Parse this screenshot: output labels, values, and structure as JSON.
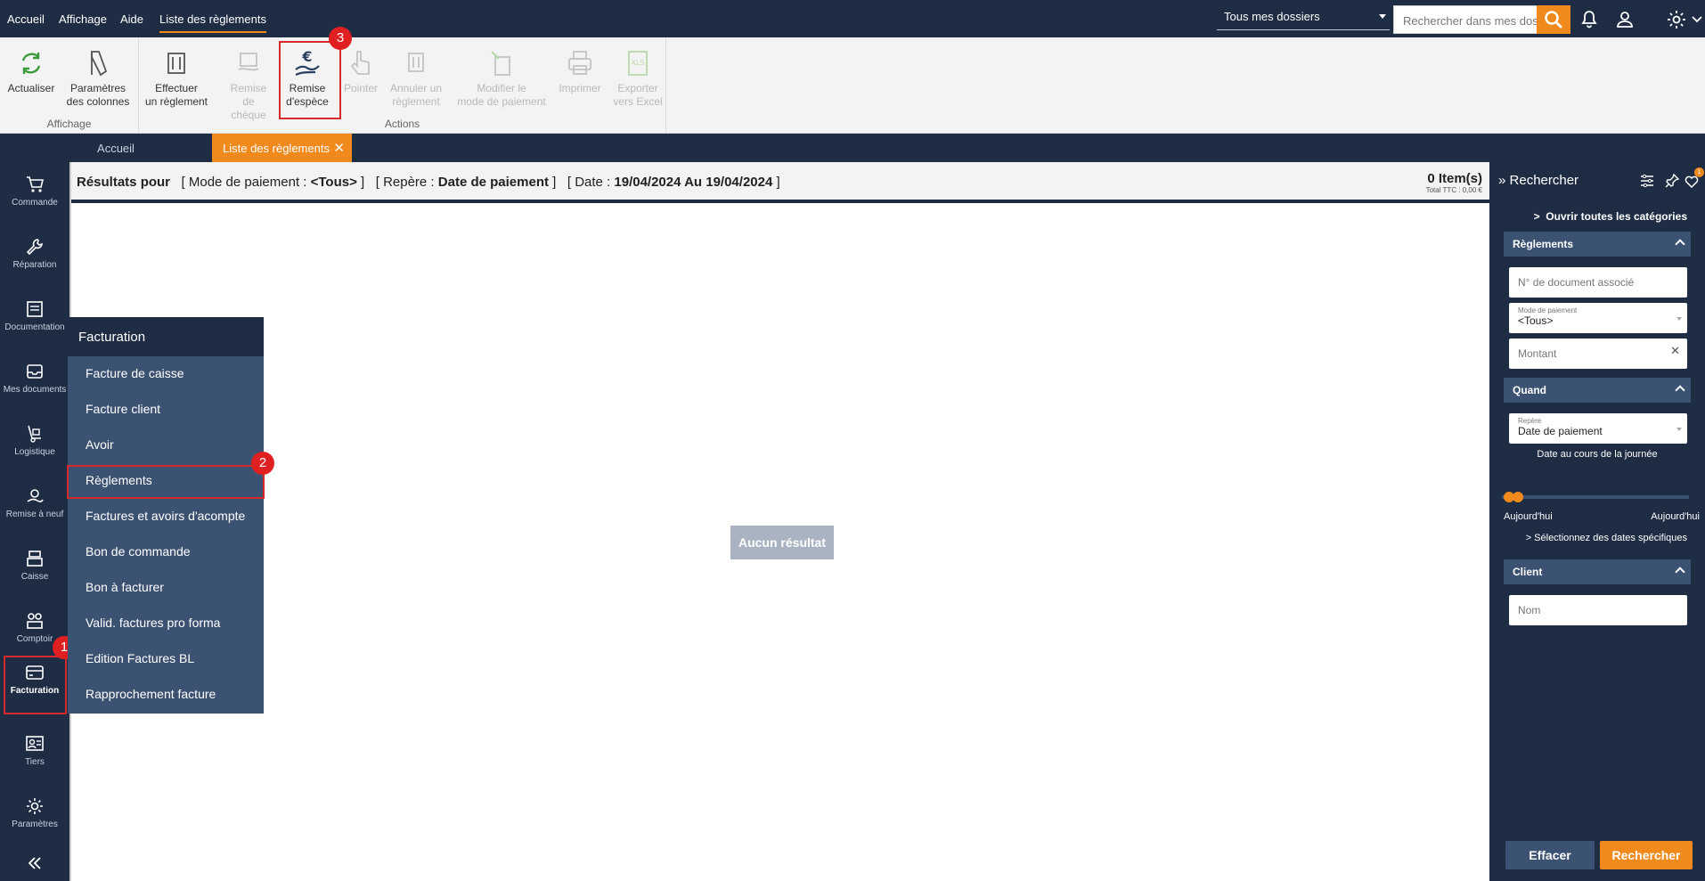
{
  "menubar": {
    "items": [
      "Accueil",
      "Affichage",
      "Aide",
      "Liste des règlements"
    ],
    "folder_select": "Tous mes dossiers",
    "search_placeholder": "Rechercher dans mes dossiers"
  },
  "ribbon": {
    "affichage": {
      "label": "Affichage",
      "buttons": [
        {
          "line1": "Actualiser",
          "line2": ""
        },
        {
          "line1": "Paramètres",
          "line2": "des colonnes"
        }
      ]
    },
    "actions": {
      "label": "Actions",
      "buttons": [
        {
          "line1": "Effectuer",
          "line2": "un règlement"
        },
        {
          "line1": "Remise",
          "line2": "de chèque"
        },
        {
          "line1": "Remise",
          "line2": "d'espèce"
        },
        {
          "line1": "Pointer",
          "line2": ""
        },
        {
          "line1": "Annuler un",
          "line2": "règlement"
        },
        {
          "line1": "Modifier le",
          "line2": "mode de paiement"
        },
        {
          "line1": "Imprimer",
          "line2": ""
        },
        {
          "line1": "Exporter",
          "line2": "vers Excel"
        }
      ]
    }
  },
  "tabs": {
    "home": "Accueil",
    "current": "Liste des règlements"
  },
  "sidebar": {
    "items": [
      "Commande",
      "Réparation",
      "Documentation",
      "Mes documents",
      "Logistique",
      "Remise à neuf",
      "Caisse",
      "Comptoir",
      "Facturation",
      "Tiers",
      "Paramètres"
    ]
  },
  "results": {
    "prefix": "Résultats pour",
    "mode_label": "[ Mode de paiement :",
    "mode_value": "<Tous>",
    "repere_label": "[ Repère :",
    "repere_value": "Date de paiement",
    "date_label": "[ Date :",
    "date_value": "19/04/2024 Au 19/04/2024",
    "close_bracket": "]",
    "count": "0 Item(s)",
    "total": "Total TTC : 0,00 €",
    "empty": "Aucun résultat"
  },
  "flyout": {
    "title": "Facturation",
    "items": [
      "Facture de caisse",
      "Facture client",
      "Avoir",
      "Règlements",
      "Factures et avoirs d'acompte",
      "Bon de commande",
      "Bon à facturer",
      "Valid. factures pro forma",
      "Edition Factures BL",
      "Rapprochement facture"
    ]
  },
  "search_panel": {
    "title": "Rechercher",
    "notif_count": "1",
    "open_all": "Ouvrir toutes les catégories",
    "sections": {
      "reglements": "Règlements",
      "quand": "Quand",
      "client": "Client"
    },
    "doc_placeholder": "N° de document associé",
    "mode_label": "Mode de paiement",
    "mode_value": "<Tous>",
    "montant_placeholder": "Montant",
    "repere_label": "Repère",
    "repere_value": "Date de paiement",
    "date_hint": "Date au cours de la journée",
    "slider_left": "Aujourd'hui",
    "slider_right": "Aujourd'hui",
    "specific_dates": "> Sélectionnez des dates spécifiques",
    "nom_placeholder": "Nom",
    "btn_clear": "Effacer",
    "btn_search": "Rechercher"
  },
  "annotations": {
    "badge1": "1",
    "badge2": "2",
    "badge3": "3"
  },
  "colors": {
    "navy": "#1e2d44",
    "accent": "#f08a1c",
    "flyout": "#3b5272",
    "highlight": "#d62a2a"
  }
}
